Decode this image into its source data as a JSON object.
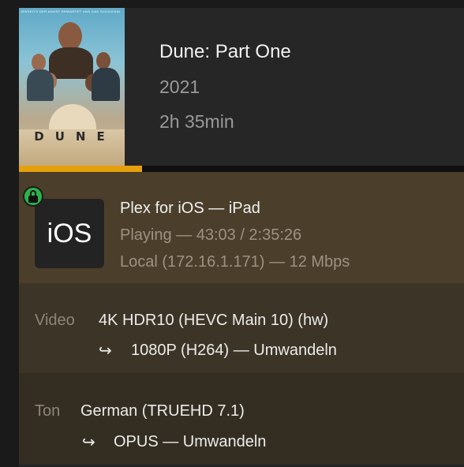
{
  "media": {
    "title": "Dune: Part One",
    "year": "2021",
    "duration": "2h 35min",
    "poster": {
      "wordmark": "DUNE",
      "tagline": "JENSEITS DER ANGST ERWARTET UNS DAS SCHICKSAL"
    }
  },
  "progress": {
    "fraction": 0.277,
    "color": "#e5a00d"
  },
  "player": {
    "secure": true,
    "platform_tile": "iOS",
    "name": "Plex for iOS  —  iPad",
    "state": "Playing — 43:03 / 2:35:26",
    "connection": "Local (172.16.1.171) — 12 Mbps"
  },
  "video": {
    "label": "Video",
    "source": "4K HDR10 (HEVC Main 10) (hw)",
    "arrow": "↪",
    "target": "1080P (H264) — Umwandeln"
  },
  "audio": {
    "label": "Ton",
    "source": "German (TRUEHD 7.1)",
    "arrow": "↪",
    "target": "OPUS — Umwandeln"
  }
}
